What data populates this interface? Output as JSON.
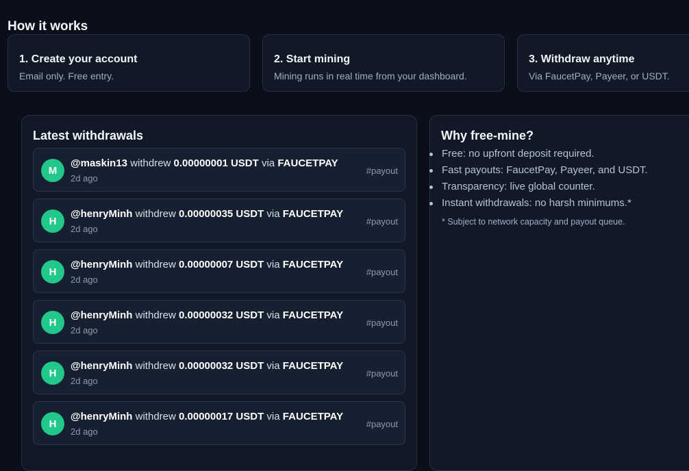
{
  "how_it_works": {
    "title": "How it works",
    "steps": [
      {
        "title": "1. Create your account",
        "desc": "Email only. Free entry."
      },
      {
        "title": "2. Start mining",
        "desc": "Mining runs in real time from your dashboard."
      },
      {
        "title": "3. Withdraw anytime",
        "desc": "Via FaucetPay, Payeer, or USDT."
      }
    ]
  },
  "withdrawals": {
    "title": "Latest withdrawals",
    "verb": "withdrew",
    "via": "via",
    "items": [
      {
        "avatar": "M",
        "user": "@maskin13",
        "amount": "0.00000001 USDT",
        "method": "FAUCETPAY",
        "time": "2d ago",
        "tag": "#payout"
      },
      {
        "avatar": "H",
        "user": "@henryMinh",
        "amount": "0.00000035 USDT",
        "method": "FAUCETPAY",
        "time": "2d ago",
        "tag": "#payout"
      },
      {
        "avatar": "H",
        "user": "@henryMinh",
        "amount": "0.00000007 USDT",
        "method": "FAUCETPAY",
        "time": "2d ago",
        "tag": "#payout"
      },
      {
        "avatar": "H",
        "user": "@henryMinh",
        "amount": "0.00000032 USDT",
        "method": "FAUCETPAY",
        "time": "2d ago",
        "tag": "#payout"
      },
      {
        "avatar": "H",
        "user": "@henryMinh",
        "amount": "0.00000032 USDT",
        "method": "FAUCETPAY",
        "time": "2d ago",
        "tag": "#payout"
      },
      {
        "avatar": "H",
        "user": "@henryMinh",
        "amount": "0.00000017 USDT",
        "method": "FAUCETPAY",
        "time": "2d ago",
        "tag": "#payout"
      }
    ]
  },
  "why": {
    "title": "Why free-mine?",
    "items": [
      "Free: no upfront deposit required.",
      "Fast payouts: FaucetPay, Payeer, and USDT.",
      "Transparency: live global counter.",
      "Instant withdrawals: no harsh minimums.*"
    ],
    "note": "* Subject to network capacity and payout queue."
  },
  "colors": {
    "background": "#0a0f19",
    "card": "#111826",
    "row": "#172030",
    "avatar": "#22c78a"
  }
}
